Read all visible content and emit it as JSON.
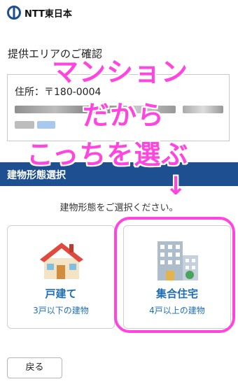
{
  "brand": {
    "name": "NTT東日本"
  },
  "section_title": "提供エリアのご確認",
  "address": {
    "label": "住所：〒180-0004"
  },
  "building_section": {
    "title": "建物形態選択",
    "prompt": "建物形態をご選択ください。"
  },
  "options": [
    {
      "title": "戸建て",
      "subtitle": "3戸以下の建物",
      "icon": "house-icon"
    },
    {
      "title": "集合住宅",
      "subtitle": "4戸以上の建物",
      "icon": "apartment-building-icon"
    }
  ],
  "back_button": "戻る",
  "annotation": {
    "line1": "マンション",
    "line2": "だから",
    "line3": "こっちを選ぶ",
    "arrow": "↓"
  },
  "colors": {
    "accent": "#1d4f91",
    "link": "#1f6fb5",
    "annotation": "#ff44e0"
  }
}
